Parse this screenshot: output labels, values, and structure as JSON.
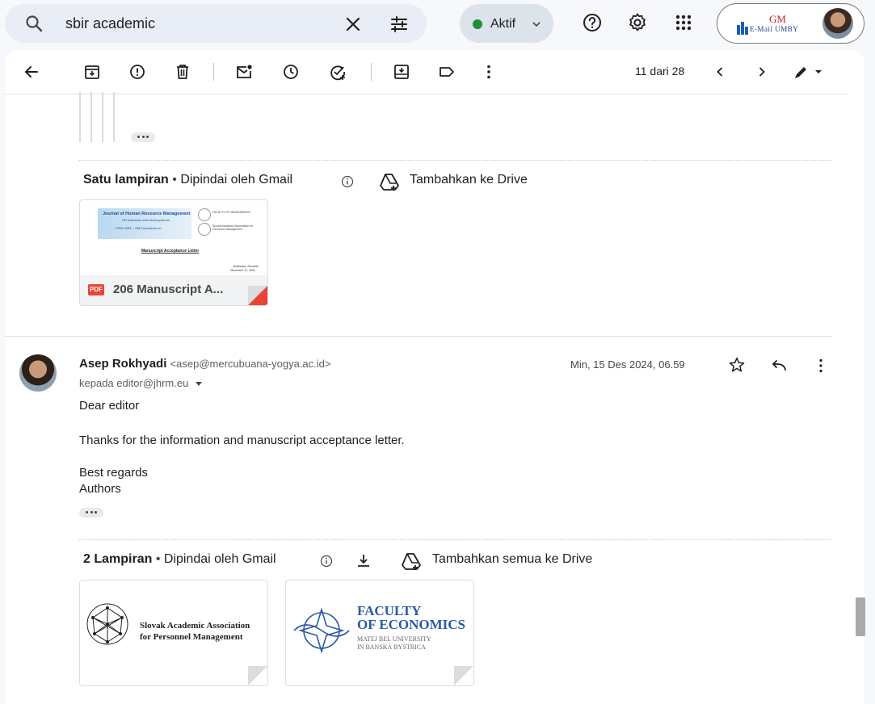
{
  "search": {
    "query": "sbir academic"
  },
  "status": {
    "label": "Aktif",
    "color": "#1e8e3e"
  },
  "account": {
    "logo_top": "GM",
    "logo_bottom": "E-Mail UMBY"
  },
  "pager": {
    "text": "11 dari 28"
  },
  "attachments1": {
    "title": "Satu lampiran",
    "scanned": "Dipindai oleh Gmail",
    "drive": "Tambahkan ke Drive",
    "file": {
      "badge": "PDF",
      "name": "206 Manuscript A...",
      "preview_header": "Journal of Human Resource Management",
      "preview_sub": "HR Advances and Developments",
      "preview_issn": "ISSN 2453 – 7683     www.jhrm.eu",
      "preview_right1": "FACULTY OF MANAGEMENT",
      "preview_right2": "Slovak Academic Association for Personnel Management",
      "preview_title": "Manuscript Acceptance Letter",
      "preview_place": "Bratislava, Slovakia",
      "preview_date": "December 12, 2024"
    }
  },
  "message": {
    "sender_name": "Asep Rokhyadi",
    "sender_email": "<asep@mercubuana-yogya.ac.id>",
    "to": "kepada editor@jhrm.eu",
    "date": "Min, 15 Des 2024, 06.59",
    "greeting": "Dear editor",
    "body": "Thanks for the information and manuscript acceptance letter.",
    "closing1": "Best regards",
    "closing2": "Authors"
  },
  "attachments2": {
    "title": "2 Lampiran",
    "scanned": "Dipindai oleh Gmail",
    "drive": "Tambahkan semua ke Drive",
    "thumb1_line1": "Slovak Academic Association",
    "thumb1_line2": "for Personnel Management",
    "thumb2_line1": "FACULTY",
    "thumb2_line2": "OF ECONOMICS",
    "thumb2_line3": "MATEJ BEL UNIVERSITY",
    "thumb2_line4": "IN BANSKÁ BYSTRICA"
  }
}
